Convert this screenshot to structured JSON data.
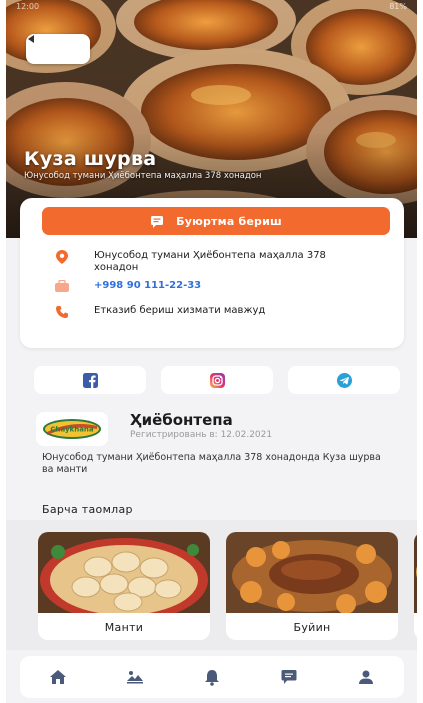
{
  "status_bar": {
    "time": "12:00",
    "battery": "81%"
  },
  "hero": {
    "title": "Куза шурва",
    "subtitle": "Юнусобод тумани Ҳиёбонтепа маҳалла 378 хонадон"
  },
  "info": {
    "order_label": "Буюртма бериш",
    "address": "Юнусобод тумани Ҳиёбонтепа маҳалла 378 хонадон",
    "phone": "+998 90 111-22-33",
    "delivery": "Етказиб бериш хизмати мавжуд"
  },
  "social": {
    "facebook_icon": "facebook-icon",
    "instagram_icon": "instagram-icon",
    "telegram_icon": "telegram-icon"
  },
  "restaurant": {
    "name": "Ҳиёбонтепа",
    "registered": "Регистрировань в: 12.02.2021",
    "description": "Юнусобод тумани Ҳиёбонтепа маҳалла 378 хонадонда Куза шурва ва манти",
    "logo_text": "Chaykhana"
  },
  "dishes_section": {
    "title": "Барча таомлар",
    "items": [
      {
        "label": "Манти"
      },
      {
        "label": "Буйин"
      },
      {
        "label": ""
      }
    ]
  },
  "bottom_nav": {
    "items": [
      "home-icon",
      "map-icon",
      "bell-icon",
      "chat-icon",
      "profile-icon"
    ]
  },
  "colors": {
    "accent": "#f26a2e",
    "phone_link": "#2f6fe0",
    "facebook": "#3b5ca8",
    "telegram": "#2a9fd8"
  }
}
